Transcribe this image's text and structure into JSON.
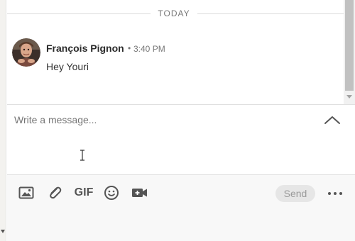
{
  "conversation": {
    "day_divider": "TODAY",
    "messages": [
      {
        "sender": "François Pignon",
        "separator": "•",
        "time": "3:40 PM",
        "text": "Hey Youri",
        "avatar_icon": "user-photo"
      }
    ]
  },
  "compose": {
    "placeholder": "Write a message...",
    "collapse_icon": "chevron-up-icon"
  },
  "toolbar": {
    "image_icon": "image-icon",
    "attach_icon": "paperclip-icon",
    "gif_label": "GIF",
    "emoji_icon": "smiley-icon",
    "video_icon": "video-camera-icon",
    "send_label": "Send",
    "more_icon": "more-options-icon"
  },
  "colors": {
    "send_disabled_bg": "#e6e6e6",
    "send_disabled_text": "#9a9a9a",
    "icon_gray": "#555555"
  }
}
